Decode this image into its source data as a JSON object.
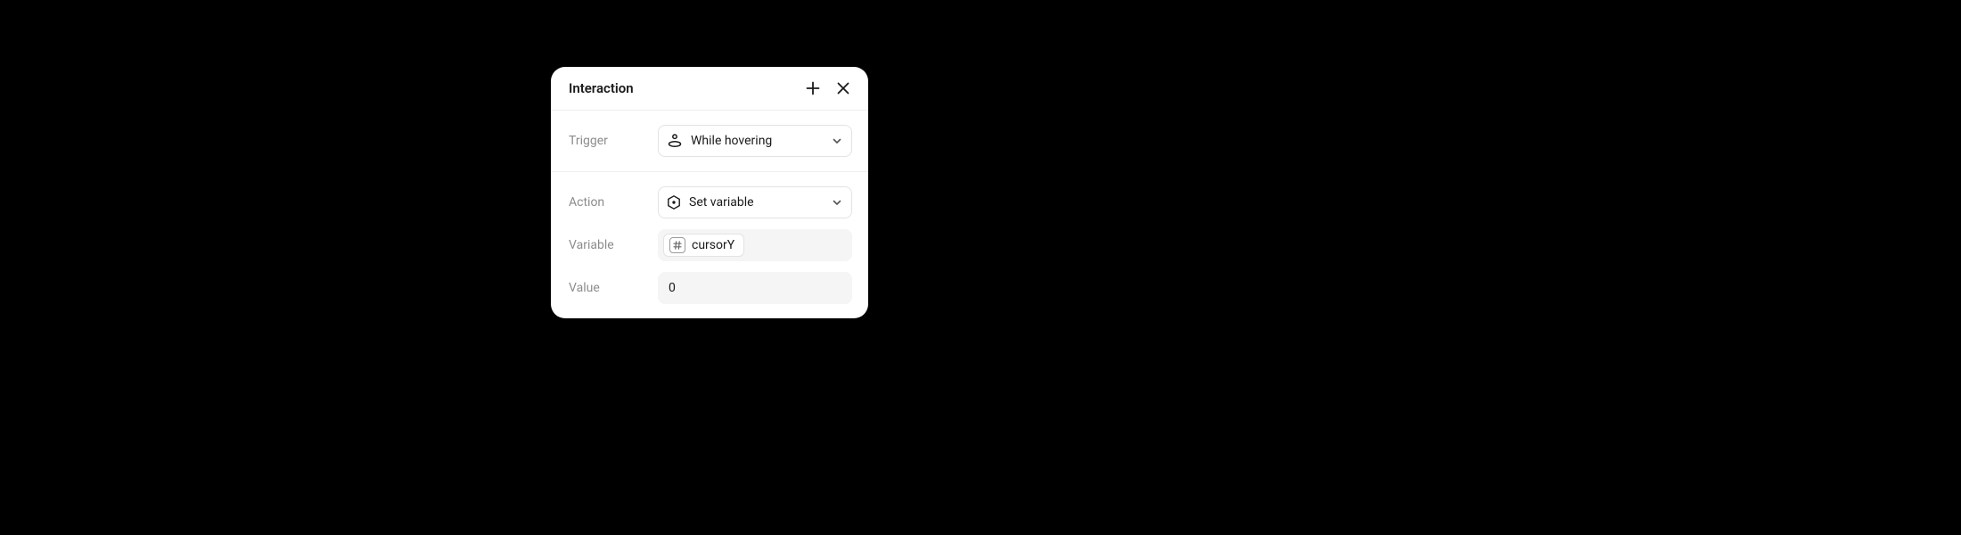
{
  "panel": {
    "title": "Interaction"
  },
  "trigger": {
    "label": "Trigger",
    "value": "While hovering"
  },
  "action": {
    "label": "Action",
    "value": "Set variable"
  },
  "variable": {
    "label": "Variable",
    "name": "cursorY"
  },
  "value": {
    "label": "Value",
    "value": "0"
  }
}
